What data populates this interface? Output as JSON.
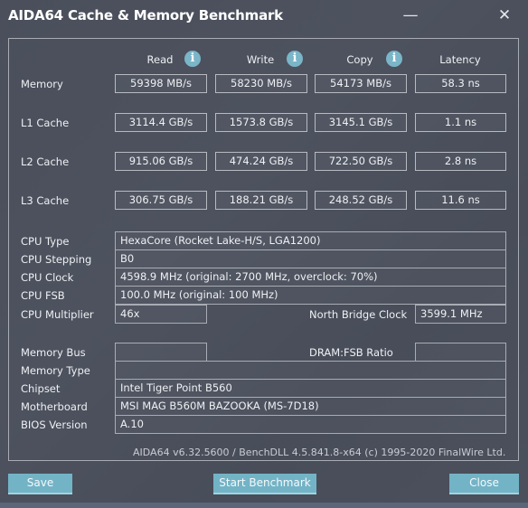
{
  "window": {
    "title": "AIDA64 Cache & Memory Benchmark",
    "minimize_glyph": "—",
    "close_glyph": "✕"
  },
  "columns": {
    "read": "Read",
    "write": "Write",
    "copy": "Copy",
    "latency": "Latency",
    "info_glyph": "i"
  },
  "bench_rows": [
    {
      "label": "Memory",
      "read": "59398 MB/s",
      "write": "58230 MB/s",
      "copy": "54173 MB/s",
      "latency": "58.3 ns"
    },
    {
      "label": "L1 Cache",
      "read": "3114.4 GB/s",
      "write": "1573.8 GB/s",
      "copy": "3145.1 GB/s",
      "latency": "1.1 ns"
    },
    {
      "label": "L2 Cache",
      "read": "915.06 GB/s",
      "write": "474.24 GB/s",
      "copy": "722.50 GB/s",
      "latency": "2.8 ns"
    },
    {
      "label": "L3 Cache",
      "read": "306.75 GB/s",
      "write": "188.21 GB/s",
      "copy": "248.52 GB/s",
      "latency": "11.6 ns"
    }
  ],
  "cpu": {
    "type_label": "CPU Type",
    "type_value": "HexaCore   (Rocket Lake-H/S, LGA1200)",
    "stepping_label": "CPU Stepping",
    "stepping_value": "B0",
    "clock_label": "CPU Clock",
    "clock_value": "4598.9 MHz  (original: 2700 MHz, overclock: 70%)",
    "fsb_label": "CPU FSB",
    "fsb_value": "100.0 MHz  (original: 100 MHz)",
    "multiplier_label": "CPU Multiplier",
    "multiplier_value": "46x",
    "nb_clock_label": "North Bridge Clock",
    "nb_clock_value": "3599.1 MHz"
  },
  "system": {
    "memory_bus_label": "Memory Bus",
    "memory_bus_value": "",
    "dram_fsb_label": "DRAM:FSB Ratio",
    "dram_fsb_value": "",
    "memory_type_label": "Memory Type",
    "memory_type_value": "",
    "chipset_label": "Chipset",
    "chipset_value": "Intel Tiger Point B560",
    "motherboard_label": "Motherboard",
    "motherboard_value": "MSI MAG B560M BAZOOKA (MS-7D18)",
    "bios_label": "BIOS Version",
    "bios_value": "A.10"
  },
  "footer": "AIDA64 v6.32.5600 / BenchDLL 4.5.841.8-x64  (c) 1995-2020 FinalWire Ltd.",
  "buttons": {
    "save": "Save",
    "start": "Start Benchmark",
    "close": "Close"
  },
  "colors": {
    "accent": "#73b3c6",
    "info_icon": "#7ab5c8",
    "background": "#4b505c"
  }
}
